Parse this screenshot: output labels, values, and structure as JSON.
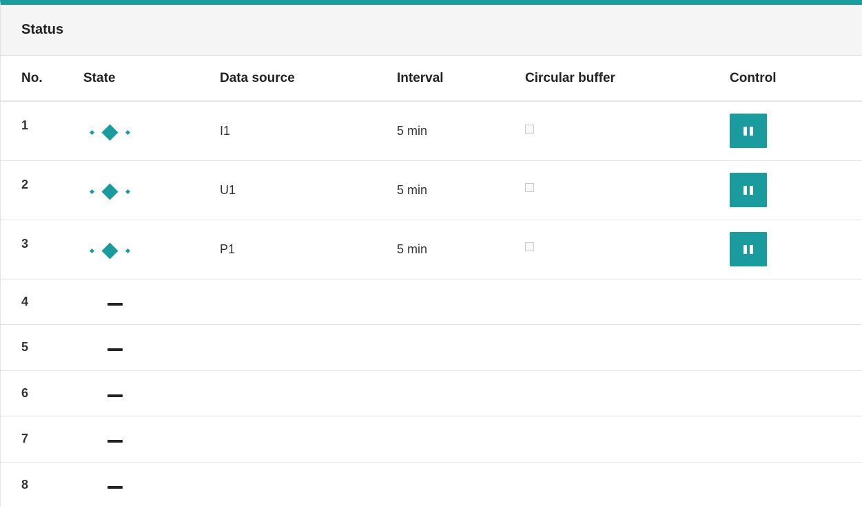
{
  "panel": {
    "title": "Status"
  },
  "table": {
    "columns": {
      "no": "No.",
      "state": "State",
      "source": "Data source",
      "interval": "Interval",
      "buffer": "Circular buffer",
      "control": "Control"
    },
    "rows": [
      {
        "no": "1",
        "state": "active",
        "source": "I1",
        "interval": "5 min",
        "buffer_checked": false
      },
      {
        "no": "2",
        "state": "active",
        "source": "U1",
        "interval": "5 min",
        "buffer_checked": false
      },
      {
        "no": "3",
        "state": "active",
        "source": "P1",
        "interval": "5 min",
        "buffer_checked": false
      },
      {
        "no": "4",
        "state": "idle"
      },
      {
        "no": "5",
        "state": "idle"
      },
      {
        "no": "6",
        "state": "idle"
      },
      {
        "no": "7",
        "state": "idle"
      },
      {
        "no": "8",
        "state": "idle"
      }
    ]
  },
  "icons": {
    "active_state": "recording-diamond-icon",
    "idle_state": "dash-icon",
    "control": "pause-icon"
  },
  "colors": {
    "accent": "#1a9c9e",
    "header_bg": "#f5f5f5"
  }
}
